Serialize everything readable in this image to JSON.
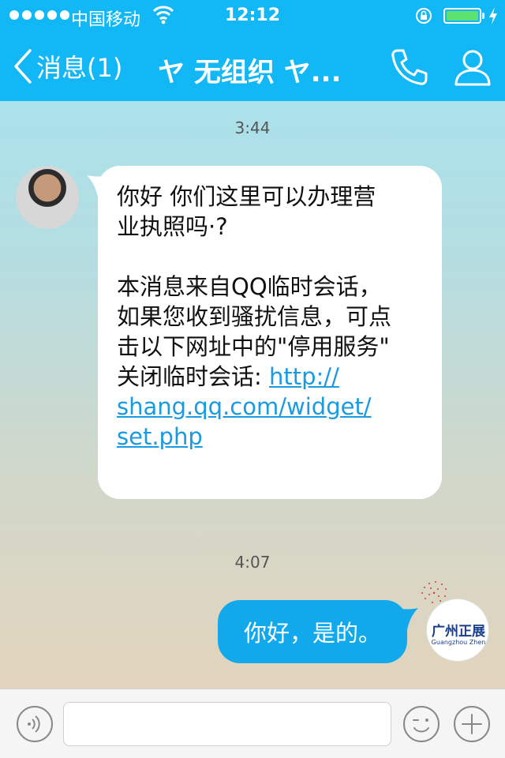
{
  "status_bar": {
    "carrier": "中国移动",
    "time": "12:12",
    "icons": [
      "signal-dots-icon",
      "wifi-icon",
      "rotation-lock-icon",
      "battery-icon",
      "charging-bolt-icon"
    ]
  },
  "nav": {
    "back_label": "消息(1)",
    "title": "ヤ 无组织 ヤ...",
    "icons": [
      "back-chevron-icon",
      "phone-icon",
      "profile-icon"
    ]
  },
  "conversation": {
    "timestamp_1": "3:44",
    "incoming_message": {
      "line_1": "你好 你们这里可以办理营",
      "line_2": "业执照吗·?",
      "line_3": "本消息来自QQ临时会话，",
      "line_4": "如果您收到骚扰信息，可点",
      "line_5": "击以下网址中的\"停用服务\"",
      "line_6_prefix": "关闭临时会话: ",
      "link_part_1": "http://",
      "link_part_2": "shang.qq.com/widget/",
      "link_part_3": "set.php"
    },
    "timestamp_2": "4:07",
    "outgoing_message": "你好，是的。",
    "own_avatar_logo": {
      "cn": "广州正展",
      "en": "Guangzhou Zhen"
    }
  },
  "input_bar": {
    "value": "",
    "icons": [
      "voice-icon",
      "emoji-icon",
      "plus-icon"
    ]
  },
  "colors": {
    "accent": "#12b7f5",
    "outgoing_bubble": "#12a8ec",
    "link": "#1a9ae0"
  }
}
